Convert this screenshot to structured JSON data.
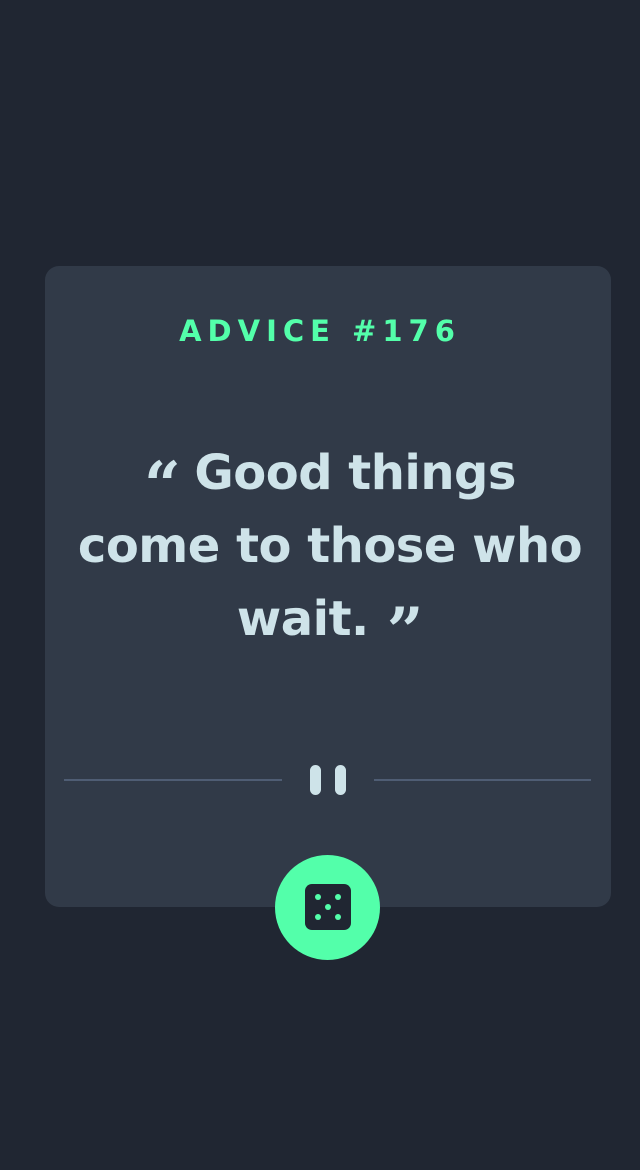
{
  "card": {
    "title": "ADVICE #176",
    "quote_open": "“",
    "quote_text": "Good things come to those who wait.",
    "quote_close": "”"
  },
  "divider": {
    "icon": "pause-icon"
  },
  "button": {
    "icon": "dice-icon"
  },
  "colors": {
    "background": "#202632",
    "card": "#313a48",
    "accent": "#53ffaa",
    "text": "#cee3e9",
    "divider": "#4f5d74"
  }
}
